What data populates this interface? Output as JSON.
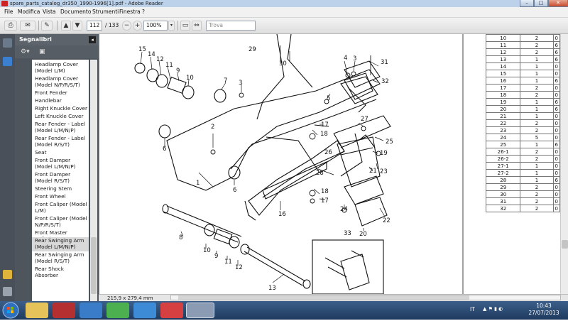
{
  "window": {
    "title": "spare_parts_catalog_dr350_1990-1996[1].pdf - Adobe Reader",
    "controls": {
      "minimize": "–",
      "maximize": "□",
      "close": "✕"
    }
  },
  "menu": [
    "File",
    "Modifica",
    "Vista",
    "Documento",
    "Strumenti",
    "Finestra",
    "?"
  ],
  "toolbar": {
    "current_page": "112",
    "page_count": "/ 133",
    "zoom": "100%",
    "search_placeholder": "Trova"
  },
  "bookmarks": {
    "header": "Segnalibri",
    "items": [
      {
        "label": "Headlamp Cover (Model L/M)",
        "lines": 2
      },
      {
        "label": "Headlamp Cover (Model N/P/R/S/T)",
        "lines": 2
      },
      {
        "label": "Front Fender",
        "lines": 1
      },
      {
        "label": "Handlebar",
        "lines": 1
      },
      {
        "label": "Right Knuckle Cover",
        "lines": 1
      },
      {
        "label": "Left Knuckle Cover",
        "lines": 1
      },
      {
        "label": "Rear Fender - Label (Model L/M/N/P)",
        "lines": 2
      },
      {
        "label": "Rear Fender - Label (Model R/S/T)",
        "lines": 2
      },
      {
        "label": "Seat",
        "lines": 1
      },
      {
        "label": "Front Damper (Model L/M/N/P)",
        "lines": 2
      },
      {
        "label": "Front Damper (Model R/S/T)",
        "lines": 2
      },
      {
        "label": "Steering Stem",
        "lines": 1
      },
      {
        "label": "Front Wheel",
        "lines": 1
      },
      {
        "label": "Front Caliper (Model L/M)",
        "lines": 2
      },
      {
        "label": "Front Caliper (Model N/P/R/S/T)",
        "lines": 2
      },
      {
        "label": "Front Master Cylinder",
        "lines": 1
      },
      {
        "label": "Rear Swinging Arm (Model L/M/N/P)",
        "lines": 2,
        "selected": true
      },
      {
        "label": "Rear Swinging Arm (Model R/S/T)",
        "lines": 2
      },
      {
        "label": "Rear Shock Absorber",
        "lines": 1
      }
    ]
  },
  "status": {
    "page_size": "215,9 x 279,4 mm"
  },
  "parts_table": {
    "rows": [
      [
        "10",
        "2",
        "0"
      ],
      [
        "11",
        "2",
        "6"
      ],
      [
        "12",
        "2",
        "6"
      ],
      [
        "13",
        "1",
        "6"
      ],
      [
        "14",
        "1",
        "0"
      ],
      [
        "15",
        "1",
        "0"
      ],
      [
        "16",
        "1",
        "6"
      ],
      [
        "17",
        "2",
        "0"
      ],
      [
        "18",
        "2",
        "0"
      ],
      [
        "19",
        "1",
        "6"
      ],
      [
        "20",
        "1",
        "6"
      ],
      [
        "21",
        "1",
        "0"
      ],
      [
        "22",
        "2",
        "0"
      ],
      [
        "23",
        "2",
        "0"
      ],
      [
        "24",
        "5",
        "0"
      ],
      [
        "25",
        "1",
        "6"
      ],
      [
        "26-1",
        "2",
        "0"
      ],
      [
        "26-2",
        "2",
        "0"
      ],
      [
        "27-1",
        "1",
        "0"
      ],
      [
        "27-2",
        "1",
        "0"
      ],
      [
        "28",
        "1",
        "6"
      ],
      [
        "29",
        "2",
        "0"
      ],
      [
        "30",
        "2",
        "0"
      ],
      [
        "31",
        "2",
        "0"
      ],
      [
        "32",
        "2",
        "0"
      ]
    ]
  },
  "diagram_labels": [
    {
      "text": "29"
    },
    {
      "text": "30"
    },
    {
      "text": "15"
    },
    {
      "text": "14"
    },
    {
      "text": "12"
    },
    {
      "text": "11"
    },
    {
      "text": "9"
    },
    {
      "text": "10"
    },
    {
      "text": "7"
    },
    {
      "text": "3"
    },
    {
      "text": "4"
    },
    {
      "text": "3"
    },
    {
      "text": "31"
    },
    {
      "text": "32"
    },
    {
      "text": "5"
    },
    {
      "text": "2"
    },
    {
      "text": "6"
    },
    {
      "text": "1"
    },
    {
      "text": "6"
    },
    {
      "text": "17"
    },
    {
      "text": "18"
    },
    {
      "text": "27"
    },
    {
      "text": "26"
    },
    {
      "text": "19"
    },
    {
      "text": "25"
    },
    {
      "text": "21"
    },
    {
      "text": "23"
    },
    {
      "text": "28"
    },
    {
      "text": "18"
    },
    {
      "text": "17"
    },
    {
      "text": "16"
    },
    {
      "text": "24"
    },
    {
      "text": "22"
    },
    {
      "text": "20"
    },
    {
      "text": "8"
    },
    {
      "text": "10"
    },
    {
      "text": "9"
    },
    {
      "text": "11"
    },
    {
      "text": "12"
    },
    {
      "text": "13"
    },
    {
      "text": "33"
    }
  ],
  "taskbar": {
    "language": "IT",
    "time": "10:43",
    "date": "27/07/2013"
  },
  "colors": {
    "accent": "#1f3a5e",
    "pdf_red": "#c22"
  }
}
